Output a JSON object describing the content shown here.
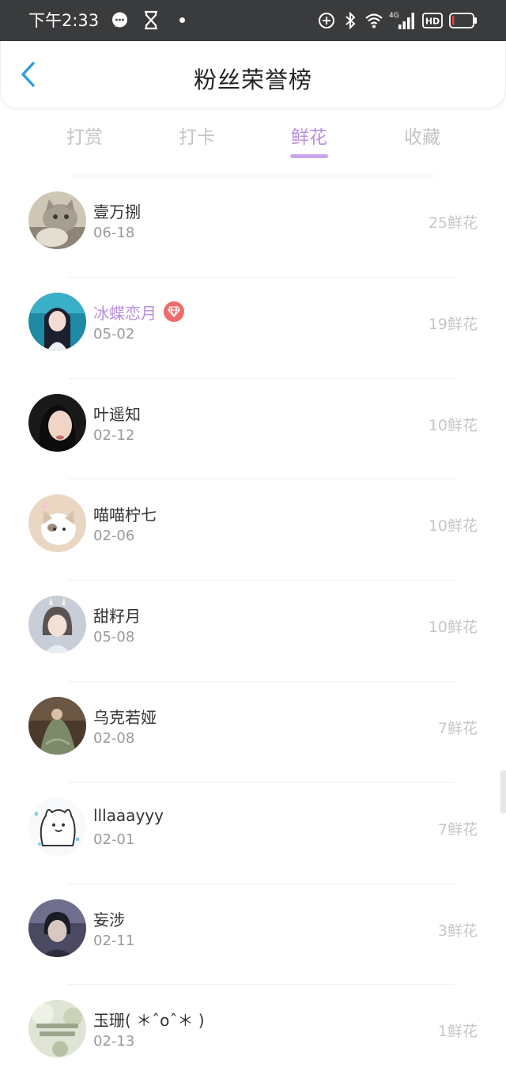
{
  "status_bar": {
    "time": "下午2:33",
    "network": "4G",
    "hd": "HD",
    "battery_level": 0.1,
    "battery_color": "#e94040"
  },
  "header": {
    "title": "粉丝荣誉榜",
    "back_icon": "chevron-left-icon",
    "back_color": "#2f9be0"
  },
  "tabs": [
    {
      "label": "打赏",
      "active": false
    },
    {
      "label": "打卡",
      "active": false
    },
    {
      "label": "鲜花",
      "active": true
    },
    {
      "label": "收藏",
      "active": false
    }
  ],
  "colors": {
    "accent": "#b98fde",
    "vip_badge": "#f26b6b",
    "muted_text": "#c6c6c6"
  },
  "fans": [
    {
      "name": "壹万捌",
      "date": "06-18",
      "count": "25鲜花",
      "vip": false
    },
    {
      "name": "冰蝶恋月",
      "date": "05-02",
      "count": "19鲜花",
      "vip": true
    },
    {
      "name": "叶遥知",
      "date": "02-12",
      "count": "10鲜花",
      "vip": false
    },
    {
      "name": "喵喵柠七",
      "date": "02-06",
      "count": "10鲜花",
      "vip": false
    },
    {
      "name": "甜籽月",
      "date": "05-08",
      "count": "10鲜花",
      "vip": false
    },
    {
      "name": "乌克若娅",
      "date": "02-08",
      "count": "7鲜花",
      "vip": false
    },
    {
      "name": "lllaaayyy",
      "date": "02-01",
      "count": "7鲜花",
      "vip": false
    },
    {
      "name": "妄涉",
      "date": "02-11",
      "count": "3鲜花",
      "vip": false
    },
    {
      "name": "玉珊( ＊ˆoˆ＊ )",
      "date": "02-13",
      "count": "1鲜花",
      "vip": false
    }
  ]
}
